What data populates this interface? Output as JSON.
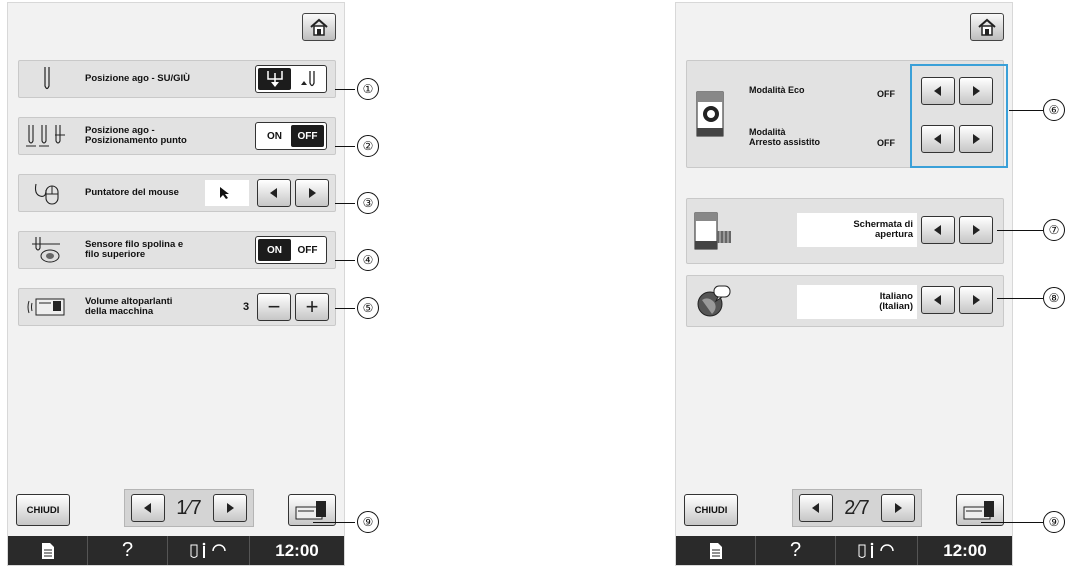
{
  "left_screen": {
    "rows": [
      {
        "label": "Posizione ago - SU/GIÙ",
        "icon": "needle-icon"
      },
      {
        "label": "Posizione ago -\nPosizionamento punto",
        "icon": "triple-needle-icon",
        "on": "ON",
        "off": "OFF",
        "active": "off"
      },
      {
        "label": "Puntatore del mouse",
        "icon": "mouse-icon"
      },
      {
        "label": "Sensore filo spolina e\nfilo superiore",
        "icon": "bobbin-sensor-icon",
        "on": "ON",
        "off": "OFF",
        "active": "on"
      },
      {
        "label": "Volume altoparlanti\ndella macchina",
        "icon": "speaker-machine-icon",
        "value": "3",
        "minus": "−",
        "plus": "+"
      }
    ],
    "close_label": "CHIUDI",
    "page": "1⁄7",
    "time": "12:00",
    "help": "?"
  },
  "right_screen": {
    "eco_label": "Modalità Eco",
    "eco_value": "OFF",
    "assist_label": "Modalità\nArresto assistito",
    "assist_value": "OFF",
    "opening_value": "Schermata di\napertura",
    "language_value": "Italiano\n(Italian)",
    "close_label": "CHIUDI",
    "page": "2⁄7",
    "time": "12:00",
    "help": "?"
  },
  "callouts": [
    "①",
    "②",
    "③",
    "④",
    "⑤",
    "⑥",
    "⑦",
    "⑧",
    "⑨",
    "⑨"
  ],
  "colors": {
    "accent_frame": "#3aa0d8",
    "status_bar": "#2a2a2a"
  }
}
